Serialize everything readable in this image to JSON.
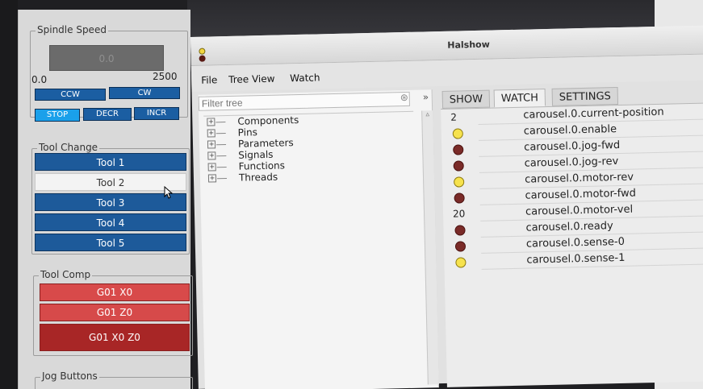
{
  "spindle": {
    "title": "Spindle Speed",
    "display": "0.0",
    "range_min": "0.0",
    "range_max": "2500",
    "ccw": "CCW",
    "cw": "CW",
    "stop": "STOP",
    "decr": "DECR",
    "incr": "INCR"
  },
  "tool_change": {
    "title": "Tool Change",
    "tools": [
      "Tool 1",
      "Tool 2",
      "Tool 3",
      "Tool 4",
      "Tool 5"
    ],
    "active_index": 1
  },
  "tool_comp": {
    "title": "Tool Comp",
    "buttons": [
      "G01 X0",
      "G01 Z0",
      "G01 X0 Z0"
    ]
  },
  "jog": {
    "title": "Jog Buttons"
  },
  "halshow": {
    "title": "Halshow",
    "menu": [
      "File",
      "Tree View",
      "Watch"
    ],
    "filter_placeholder": "Filter tree",
    "tree": [
      "Components",
      "Pins",
      "Parameters",
      "Signals",
      "Functions",
      "Threads"
    ],
    "tabs": [
      "SHOW",
      "WATCH",
      "SETTINGS"
    ],
    "active_tab": "WATCH",
    "watch": [
      {
        "name": "carousel.0.current-position",
        "kind": "value",
        "value": "2"
      },
      {
        "name": "carousel.0.enable",
        "kind": "led",
        "on": true
      },
      {
        "name": "carousel.0.jog-fwd",
        "kind": "led",
        "on": false
      },
      {
        "name": "carousel.0.jog-rev",
        "kind": "led",
        "on": false
      },
      {
        "name": "carousel.0.motor-rev",
        "kind": "led",
        "on": true
      },
      {
        "name": "carousel.0.motor-fwd",
        "kind": "led",
        "on": false
      },
      {
        "name": "carousel.0.motor-vel",
        "kind": "value",
        "value": "20"
      },
      {
        "name": "carousel.0.ready",
        "kind": "led",
        "on": false
      },
      {
        "name": "carousel.0.sense-0",
        "kind": "led",
        "on": false
      },
      {
        "name": "carousel.0.sense-1",
        "kind": "led",
        "on": true
      }
    ]
  },
  "colors": {
    "tool_blue": "#1d5a9a",
    "stop_cyan": "#1aa0ea",
    "red_light": "#d94a4a",
    "red_dark": "#a82626",
    "led_on": "#f6e24d",
    "led_off": "#7a2b28"
  }
}
